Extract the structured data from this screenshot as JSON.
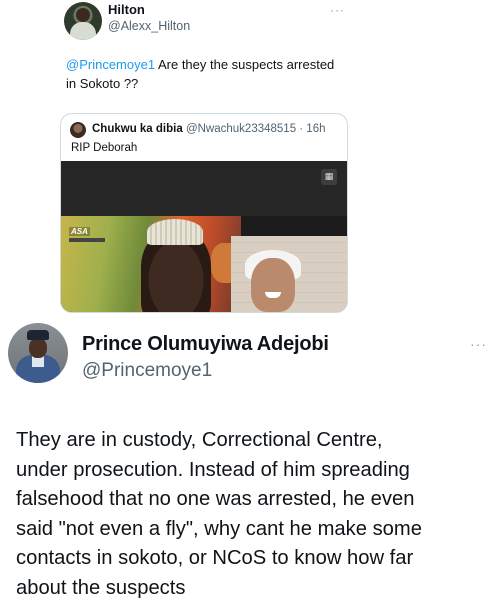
{
  "top_tweet": {
    "display_name": "Hilton",
    "handle": "@Alexx_Hilton",
    "more_label": "···",
    "mention": "@Princemoye1",
    "text_line1_rest": " Are they the suspects arrested",
    "text_line2": "in Sokoto ??"
  },
  "quoted_tweet": {
    "display_name": "Chukwu ka dibia",
    "handle_time": "@Nwachuk23348515 · 16h",
    "text": "RIP Deborah",
    "media_logo": "ASA",
    "gif_icon": "gif-icon"
  },
  "main_tweet": {
    "display_name": "Prince Olumuyiwa Adejobi",
    "handle": "@Princemoye1",
    "more_label": "···",
    "lines": [
      "They are in custody, Correctional Centre,",
      "under prosecution. Instead of him spreading",
      "falsehood that no one was arrested, he even",
      "said \"not even a fly\",  why cant he make some",
      "contacts in sokoto, or NCoS to know how far",
      "about the suspects"
    ]
  }
}
